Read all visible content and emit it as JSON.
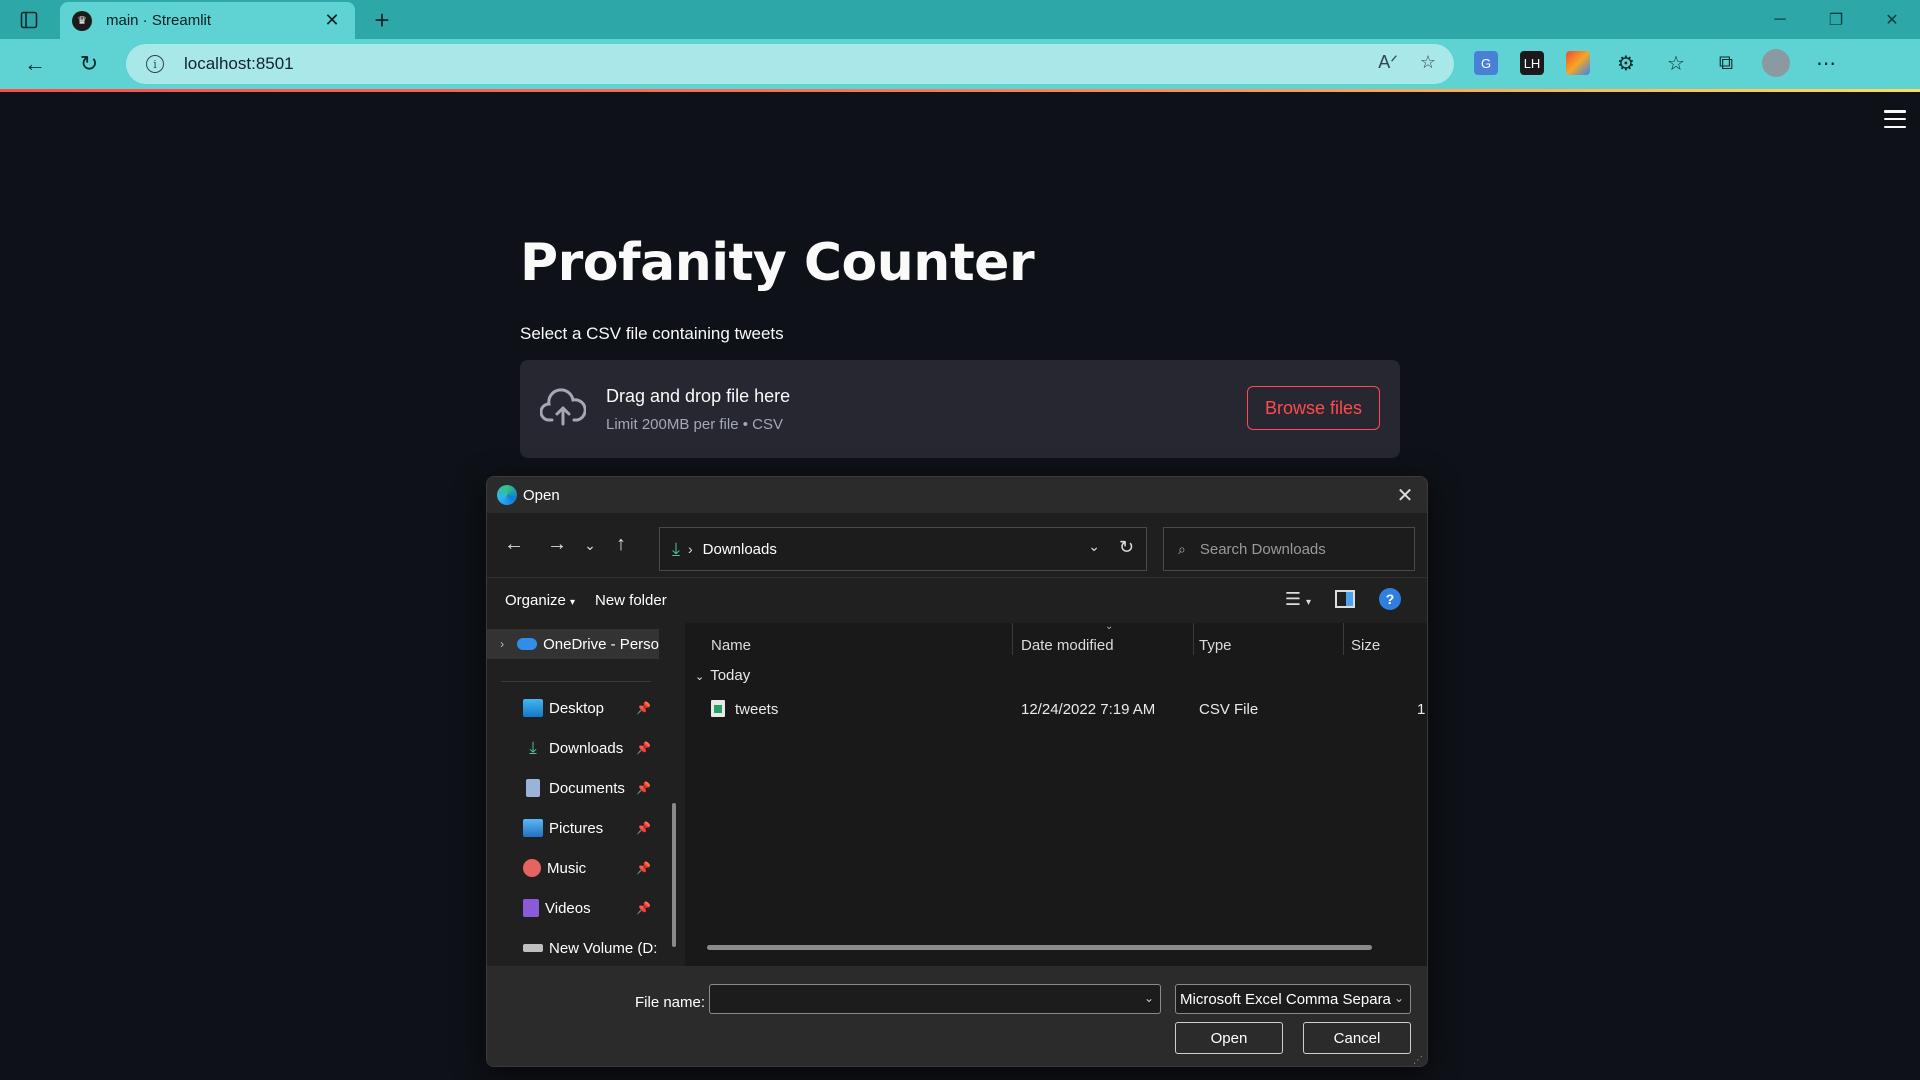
{
  "browser": {
    "tab_title": "main · Streamlit",
    "url": "localhost:8501",
    "colors": {
      "accent": "#5fd3d4",
      "tabstrip": "#2ea7a8"
    }
  },
  "app": {
    "title": "Profanity Counter",
    "uploader_label": "Select a CSV file containing tweets",
    "drop_title": "Drag and drop file here",
    "drop_subtitle": "Limit 200MB per file • CSV",
    "browse_label": "Browse files",
    "colors": {
      "primary": "#ff4b4b",
      "background": "#0e1117",
      "panel": "#262730"
    }
  },
  "dialog": {
    "title": "Open",
    "path": "Downloads",
    "search_placeholder": "Search Downloads",
    "organize_label": "Organize",
    "new_folder_label": "New folder",
    "nav_items": [
      {
        "label": "OneDrive - Perso",
        "icon": "onedrive-icon"
      },
      {
        "label": "Desktop",
        "icon": "desktop-icon"
      },
      {
        "label": "Downloads",
        "icon": "downloads-icon"
      },
      {
        "label": "Documents",
        "icon": "documents-icon"
      },
      {
        "label": "Pictures",
        "icon": "pictures-icon"
      },
      {
        "label": "Music",
        "icon": "music-icon"
      },
      {
        "label": "Videos",
        "icon": "videos-icon"
      },
      {
        "label": "New Volume (D:",
        "icon": "drive-icon"
      }
    ],
    "columns": [
      "Name",
      "Date modified",
      "Type",
      "Size"
    ],
    "group_label": "Today",
    "files": [
      {
        "name": "tweets",
        "date": "12/24/2022 7:19 AM",
        "type": "CSV File",
        "size": "1"
      }
    ],
    "file_name_label": "File name:",
    "file_name_value": "",
    "file_type": "Microsoft Excel Comma Separa",
    "open_label": "Open",
    "cancel_label": "Cancel"
  }
}
